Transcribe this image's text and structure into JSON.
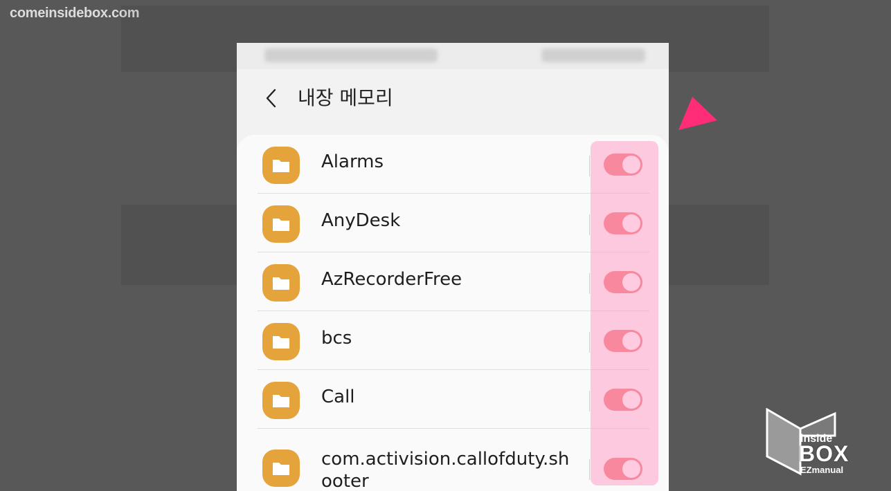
{
  "watermark": {
    "site_text": "comeinsidebox.com"
  },
  "header": {
    "title": "내장 메모리"
  },
  "folders": [
    {
      "label": "Alarms",
      "enabled": true
    },
    {
      "label": "AnyDesk",
      "enabled": true
    },
    {
      "label": "AzRecorderFree",
      "enabled": true
    },
    {
      "label": "bcs",
      "enabled": true
    },
    {
      "label": "Call",
      "enabled": true
    },
    {
      "label": "com.activision.callofduty.shooter",
      "enabled": true
    }
  ],
  "logo": {
    "top_text": "inside",
    "main_text": "BOX",
    "bottom_text": "EZmanual"
  },
  "colors": {
    "background": "#585858",
    "folder_icon": "#e5a33c",
    "toggle_on": "#f06b6b",
    "highlight": "#ffa0c8",
    "arrow": "#ff2d78"
  }
}
